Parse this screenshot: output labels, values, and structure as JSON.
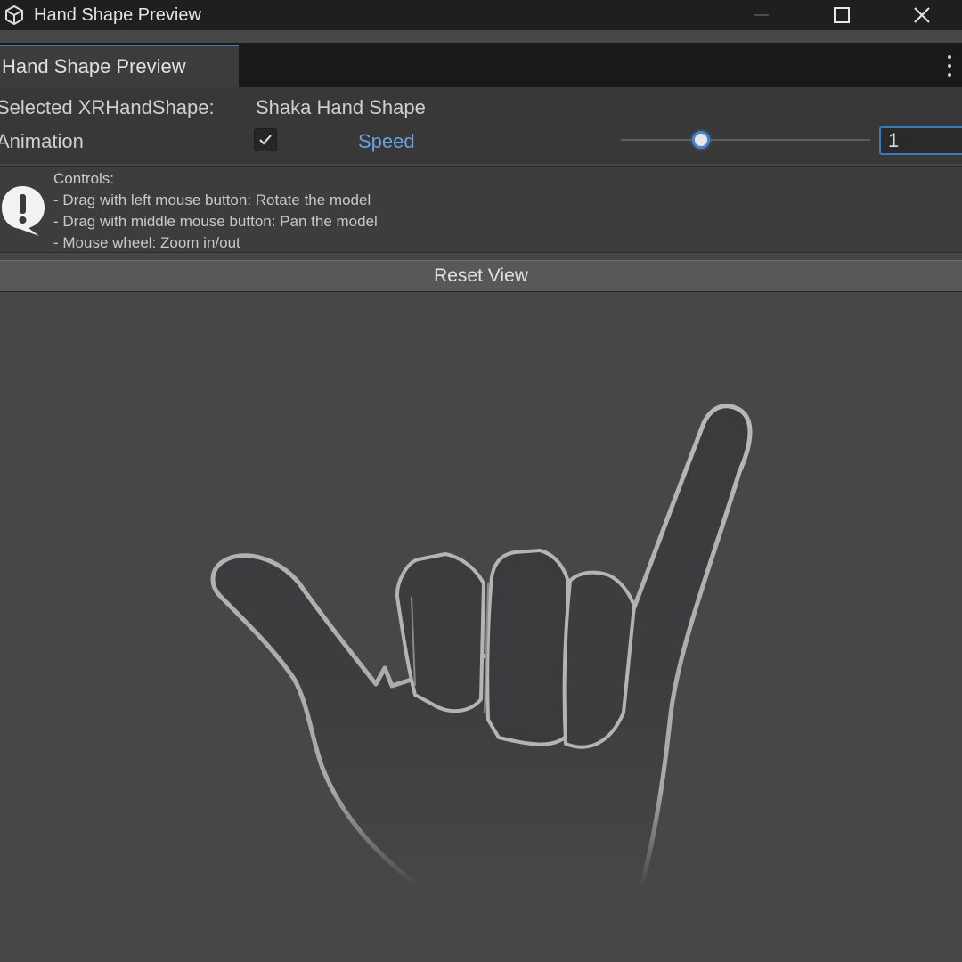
{
  "window": {
    "title": "Hand Shape Preview",
    "app_icon": "unity-cube-icon",
    "controls": [
      "minimize-icon",
      "maximize-icon",
      "close-icon"
    ]
  },
  "tab": {
    "label": "Hand Shape Preview",
    "menu_icon": "kebab-menu-icon"
  },
  "inspector": {
    "selected_label": "Selected XRHandShape:",
    "selected_value": "Shaka Hand Shape",
    "animation_label": "Animation",
    "animation_checked": true,
    "speed_label": "Speed",
    "speed_value": "1"
  },
  "help": {
    "icon": "info-exclamation-icon",
    "lines": [
      "Controls:",
      "- Drag with left mouse button: Rotate the model",
      "- Drag with middle mouse button: Pan the model",
      "- Mouse wheel: Zoom in/out"
    ]
  },
  "reset_button": "Reset View",
  "viewport": {
    "model": "shaka-hand-model"
  },
  "colors": {
    "accent": "#3a79bb",
    "speed_label": "#6a9fe0",
    "viewport_bg": "#474747",
    "titlebar_bg": "#1f1f1f"
  }
}
